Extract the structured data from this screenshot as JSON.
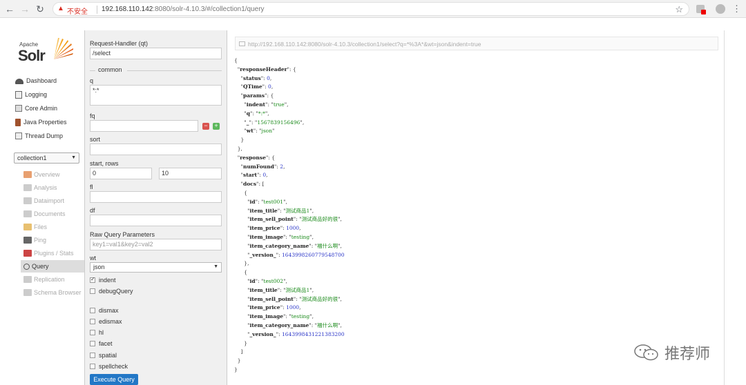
{
  "browser": {
    "security_label": "不安全",
    "url_host": "192.168.110.142",
    "url_rest": ":8080/solr-4.10.3/#/collection1/query"
  },
  "logo": {
    "apache": "Apache",
    "solr": "Solr"
  },
  "nav": {
    "items": [
      {
        "label": "Dashboard",
        "icon": "dashboard-icon"
      },
      {
        "label": "Logging",
        "icon": "logging-icon"
      },
      {
        "label": "Core Admin",
        "icon": "core-admin-icon"
      },
      {
        "label": "Java Properties",
        "icon": "java-properties-icon"
      },
      {
        "label": "Thread Dump",
        "icon": "thread-dump-icon"
      }
    ],
    "collection": "collection1",
    "sub_items": [
      {
        "label": "Overview"
      },
      {
        "label": "Analysis"
      },
      {
        "label": "Dataimport"
      },
      {
        "label": "Documents"
      },
      {
        "label": "Files"
      },
      {
        "label": "Ping"
      },
      {
        "label": "Plugins / Stats"
      },
      {
        "label": "Query"
      },
      {
        "label": "Replication"
      },
      {
        "label": "Schema Browser"
      }
    ]
  },
  "form": {
    "request_handler_label": "Request-Handler (qt)",
    "request_handler_value": "/select",
    "common_label": "common",
    "q_label": "q",
    "q_value": "*:*",
    "fq_label": "fq",
    "sort_label": "sort",
    "start_rows_label": "start, rows",
    "start_value": "0",
    "rows_value": "10",
    "fl_label": "fl",
    "df_label": "df",
    "raw_label": "Raw Query Parameters",
    "raw_placeholder": "key1=val1&key2=val2",
    "wt_label": "wt",
    "wt_value": "json",
    "indent_label": "indent",
    "debug_label": "debugQuery",
    "dismax_label": "dismax",
    "edismax_label": "edismax",
    "hl_label": "hl",
    "facet_label": "facet",
    "spatial_label": "spatial",
    "spellcheck_label": "spellcheck",
    "execute_label": "Execute Query"
  },
  "result": {
    "request_url": "http://192.168.110.142:8080/solr-4.10.3/collection1/select?q=*%3A*&wt=json&indent=true",
    "status": "0",
    "qtime": "0",
    "indent": "true",
    "q": "*:*",
    "underscore": "1567839156496",
    "wt": "json",
    "numFound": "2",
    "start": "0",
    "docs": [
      {
        "id": "test001",
        "item_title": "测试商品1",
        "item_sell_point": "测试商品好的很",
        "item_price": "1000",
        "item_image": "testing",
        "item_category_name": "福什么啊",
        "version": "1643998260779548700"
      },
      {
        "id": "test002",
        "item_title": "测试商品1",
        "item_sell_point": "测试商品好的很",
        "item_price": "1000",
        "item_image": "testing",
        "item_category_name": "福什么啊",
        "version": "1643998431221383200"
      }
    ]
  },
  "watermark": "推荐师"
}
